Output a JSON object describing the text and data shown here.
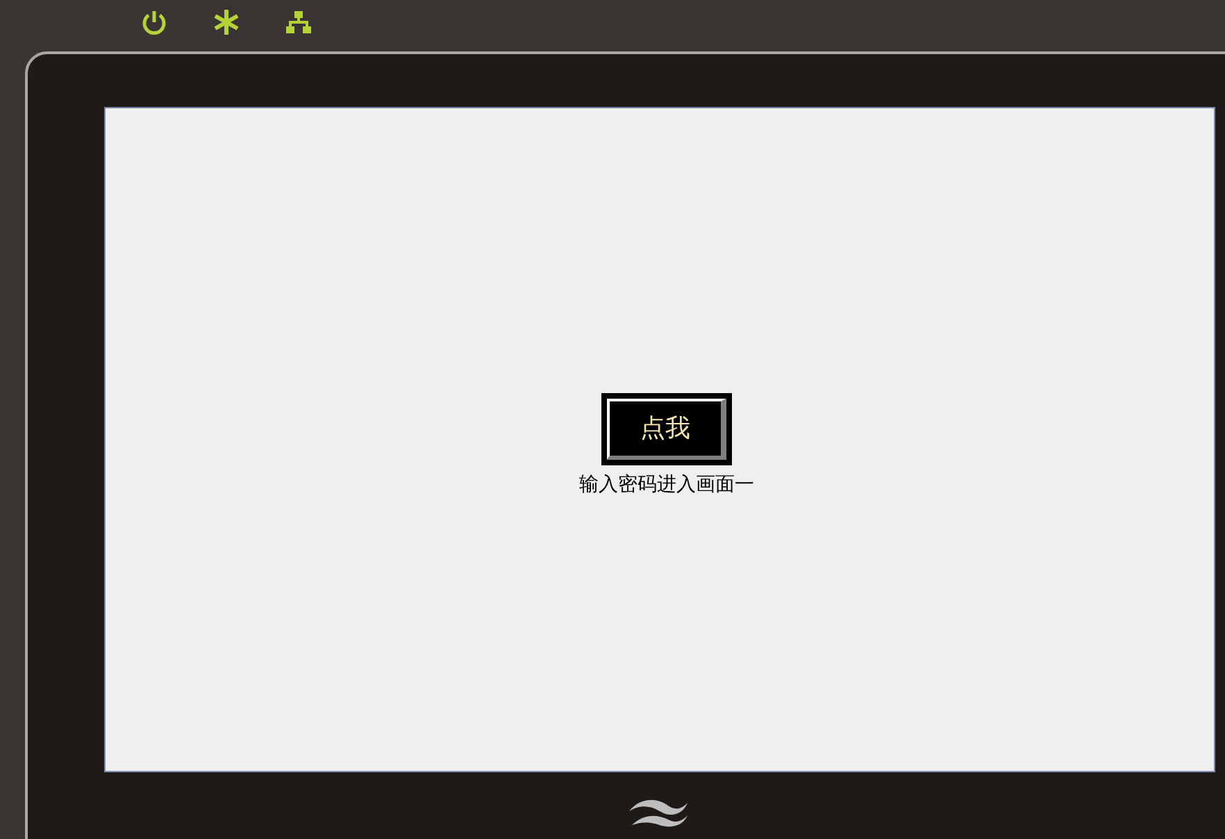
{
  "screen": {
    "button": {
      "label": "点我"
    },
    "caption": "输入密码进入画面一"
  }
}
